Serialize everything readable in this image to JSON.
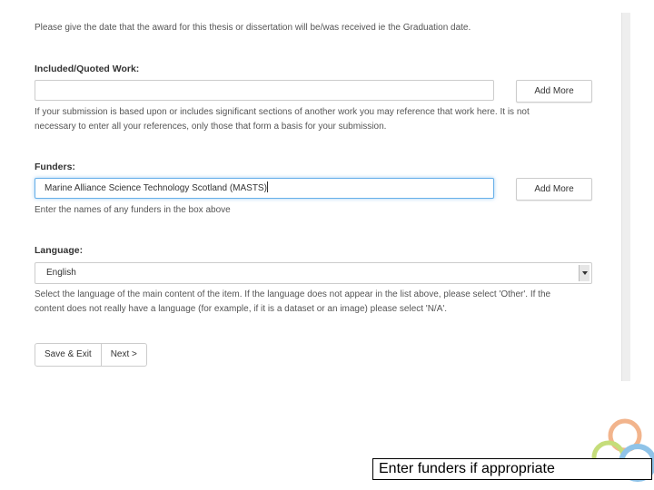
{
  "date_help": "Please give the date that the award for this thesis or dissertation will be/was received ie the Graduation date.",
  "included_work": {
    "label": "Included/Quoted Work:",
    "value": "",
    "add_more_label": "Add More",
    "help_line1": "If your submission is based upon or includes significant sections of another work you may reference that work here. It is not",
    "help_line2": "necessary to enter all your references, only those that form a basis for your submission."
  },
  "funders": {
    "label": "Funders:",
    "value": "Marine Alliance Science Technology Scotland (MASTS)",
    "add_more_label": "Add More",
    "help": "Enter the names of any funders in the box above"
  },
  "language": {
    "label": "Language:",
    "selected": "English",
    "help_line1": "Select the language of the main content of the item. If the language does not appear in the list above, please select 'Other'. If the",
    "help_line2": "content does not really have a language (for example, if it is a dataset or an image) please select 'N/A'."
  },
  "actions": {
    "save_exit_label": "Save & Exit",
    "next_label": "Next >"
  },
  "caption": "Enter funders if appropriate",
  "colors": {
    "focus_border": "#66afe9",
    "ring_orange": "#f2b48c",
    "ring_green": "#c5dd7a",
    "ring_blue": "#8fc3e8"
  }
}
